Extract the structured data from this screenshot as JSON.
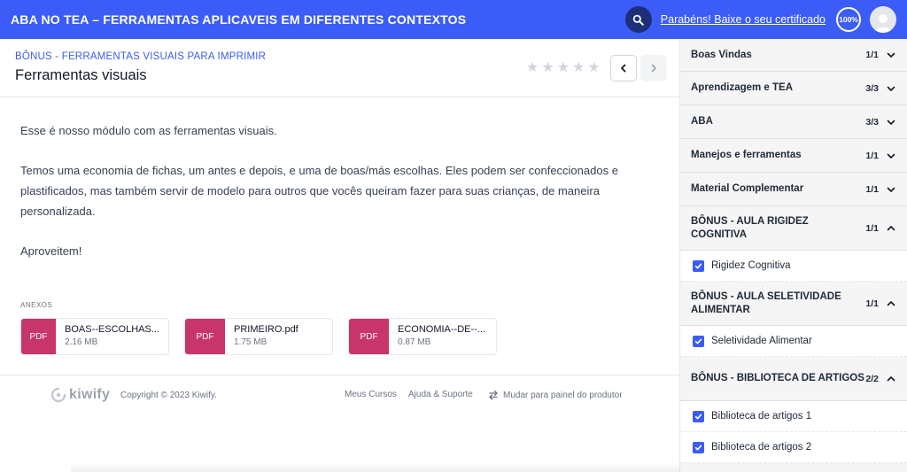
{
  "header": {
    "course_title": "ABA NO TEA – FERRAMENTAS APLICAVEIS EM DIFERENTES CONTEXTOS",
    "certificate_link": "Parabéns! Baixe o seu certificado",
    "progress_label": "100%",
    "colors": {
      "primary": "#3b5cf6",
      "search_bg": "#1e2f7a"
    }
  },
  "lesson": {
    "module": "BÔNUS - FERRAMENTAS VISUAIS PARA IMPRIMIR",
    "title": "Ferramentas visuais",
    "rating_max": 5,
    "rating": 0,
    "paragraphs": [
      "Esse é nosso módulo com as ferramentas visuais.",
      "Temos uma economia de fichas, um antes e depois, e uma de boas/más escolhas. Eles podem ser confeccionados e plastificados, mas também servir de modelo para outros que vocês queiram fazer para suas crianças, de maneira personalizada.",
      "Aproveitem!"
    ],
    "attachments_label": "ANEXOS",
    "attachments": [
      {
        "type": "PDF",
        "name": "BOAS--ESCOLHAS...",
        "size": "2.16 MB"
      },
      {
        "type": "PDF",
        "name": "PRIMEIRO.pdf",
        "size": "1.75 MB"
      },
      {
        "type": "PDF",
        "name": "ECONOMIA--DE--...",
        "size": "0.87 MB"
      }
    ]
  },
  "footer": {
    "logo_text": "kiwify",
    "copyright": "Copyright © 2023 Kiwify.",
    "links": [
      "Meus Cursos",
      "Ajuda & Suporte",
      "Mudar para painel do produtor"
    ]
  },
  "sidebar": {
    "sections": [
      {
        "title": "Boas Vindas",
        "count": "1/1",
        "expanded": false,
        "lessons": []
      },
      {
        "title": "Aprendizagem e TEA",
        "count": "3/3",
        "expanded": false,
        "lessons": []
      },
      {
        "title": "ABA",
        "count": "3/3",
        "expanded": false,
        "lessons": []
      },
      {
        "title": "Manejos e ferramentas",
        "count": "1/1",
        "expanded": false,
        "lessons": []
      },
      {
        "title": "Material Complementar",
        "count": "1/1",
        "expanded": false,
        "lessons": []
      },
      {
        "title": "BÔNUS - AULA RIGIDEZ COGNITIVA",
        "count": "1/1",
        "expanded": true,
        "lessons": [
          "Rigidez Cognitiva"
        ]
      },
      {
        "title": "BÔNUS - AULA SELETIVIDADE ALIMENTAR",
        "count": "1/1",
        "expanded": true,
        "lessons": [
          "Seletividade Alimentar"
        ]
      },
      {
        "title": "BÔNUS - BIBLIOTECA DE ARTIGOS",
        "count": "2/2",
        "expanded": true,
        "lessons": [
          "Biblioteca de artigos 1",
          "Biblioteca de artigos 2"
        ]
      }
    ]
  }
}
